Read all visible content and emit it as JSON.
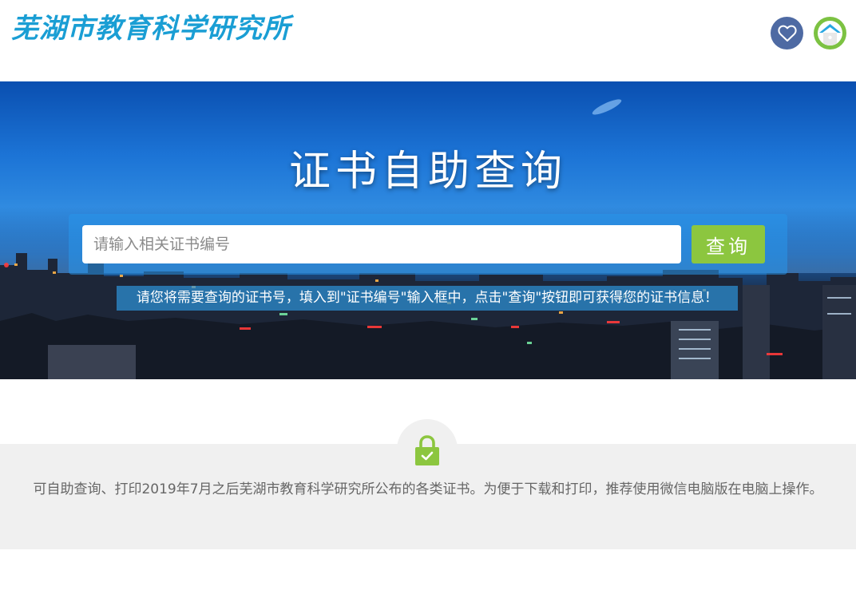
{
  "header": {
    "logo_text": "芜湖市教育科学研究所",
    "icons": {
      "favorite": "heart-icon",
      "home": "home-icon"
    },
    "colors": {
      "logo": "#1a9ed4",
      "favorite_bg": "#4e6aa3",
      "home_bg": "#7cc242"
    }
  },
  "banner": {
    "title": "证书自助查询",
    "search": {
      "placeholder": "请输入相关证书编号",
      "value": "",
      "button_label": "查询"
    },
    "hint": "请您将需要查询的证书号，填入到\"证书编号\"输入框中，点击\"查询\"按钮即可获得您的证书信息！",
    "colors": {
      "button": "#8cc63f",
      "search_panel": "#2896eb"
    }
  },
  "info": {
    "icon": "lock-icon",
    "text": "可自助查询、打印2019年7月之后芜湖市教育科学研究所公布的各类证书。为便于下载和打印，推荐使用微信电脑版在电脑上操作。",
    "colors": {
      "lock": "#8cc63f",
      "background": "#f0f0f0"
    }
  }
}
